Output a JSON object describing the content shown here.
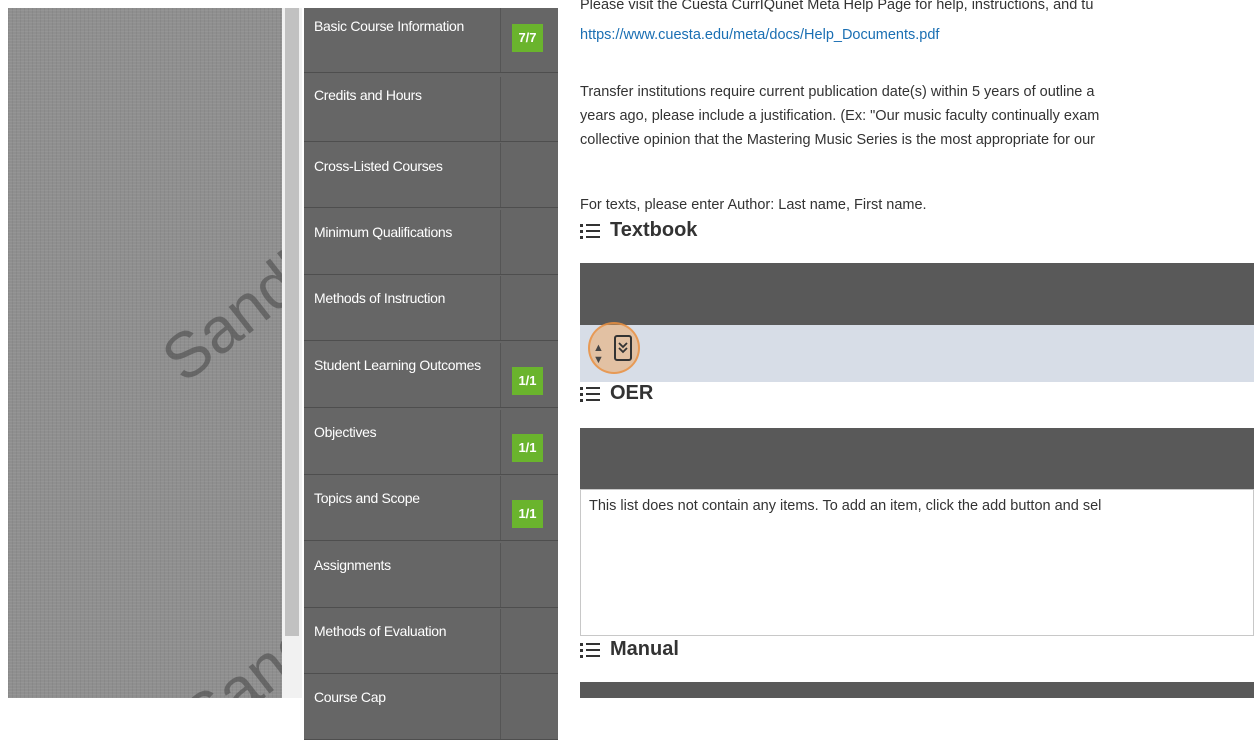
{
  "watermark": {
    "text": "Sandbox"
  },
  "nav": {
    "items": [
      {
        "label": "Basic Course Information",
        "badge": "7/7"
      },
      {
        "label": "Credits and Hours",
        "badge": ""
      },
      {
        "label": "Cross-Listed Courses",
        "badge": ""
      },
      {
        "label": "Minimum Qualifications",
        "badge": ""
      },
      {
        "label": "Methods of Instruction",
        "badge": ""
      },
      {
        "label": "Student Learning Outcomes",
        "badge": "1/1"
      },
      {
        "label": "Objectives",
        "badge": "1/1"
      },
      {
        "label": "Topics and Scope",
        "badge": "1/1"
      },
      {
        "label": "Assignments",
        "badge": ""
      },
      {
        "label": "Methods of Evaluation",
        "badge": ""
      },
      {
        "label": "Course Cap",
        "badge": ""
      }
    ],
    "badge_color": "#6ab42d"
  },
  "main": {
    "intro_line1": "Please visit the Cuesta CurrIQunet Meta Help Page for help, instructions, and tu",
    "help_link": "https://www.cuesta.edu/meta/docs/Help_Documents.pdf",
    "transfer_line1": "Transfer institutions require current publication date(s) within 5 years of outline a",
    "transfer_line2": "years ago, please include a justification. (Ex: \"Our music faculty continually exam",
    "transfer_line3": "collective opinion that the Mastering Music Series is the most appropriate for our",
    "texts_note": "For texts, please enter Author: Last name, First name.",
    "sections": {
      "textbook": "Textbook",
      "oer": "OER",
      "manual": "Manual"
    },
    "oer_empty": "This list does not contain any items. To add an item, click the add button and sel"
  },
  "icons": {
    "list": "list-icon",
    "sort": "sort-handle-icon",
    "expand": "chevron-double-down-icon"
  }
}
